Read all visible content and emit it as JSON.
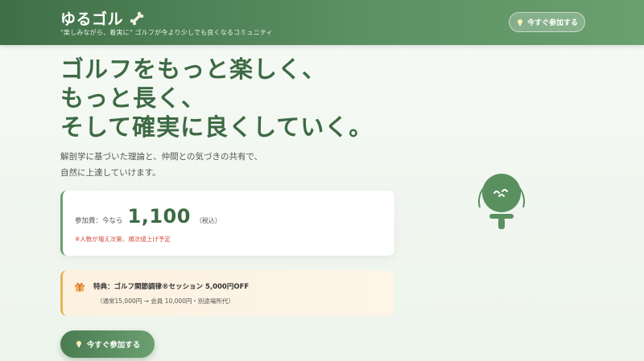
{
  "header": {
    "brand": "ゆるゴル",
    "tagline": "\"楽しみながら、着実に\" ゴルフが今より少しでも良くなるコミュニティ",
    "cta_label": "今すぐ参加する"
  },
  "hero": {
    "headline": [
      "ゴルフをもっと楽しく、",
      "もっと長く、",
      "そして確実に良くしていく。"
    ],
    "lead": [
      "解剖学に基づいた理論と、仲間との気づきの共有で、",
      "自然に上達していけます。"
    ]
  },
  "pricing": {
    "label": "参加費：今なら",
    "price": "1,100",
    "tax": "（税込）",
    "note": "※人数が増え次第、順次値上げ予定"
  },
  "benefit": {
    "title": "特典：ゴルフ関節調律®セッション 5,000円OFF",
    "detail": "（通常15,000円 → 会員 10,000円・別途場所代）"
  },
  "cta": {
    "label": "今すぐ参加する"
  },
  "colors": {
    "brand_green": "#3d6a44",
    "accent_gold": "#e7b459",
    "note_red": "#d24a3a"
  },
  "icons": {
    "brand": "bone-icon",
    "cta": "lightbulb-icon",
    "benefit": "gift-icon",
    "illustration": "golf-ball-on-tee-icon"
  }
}
